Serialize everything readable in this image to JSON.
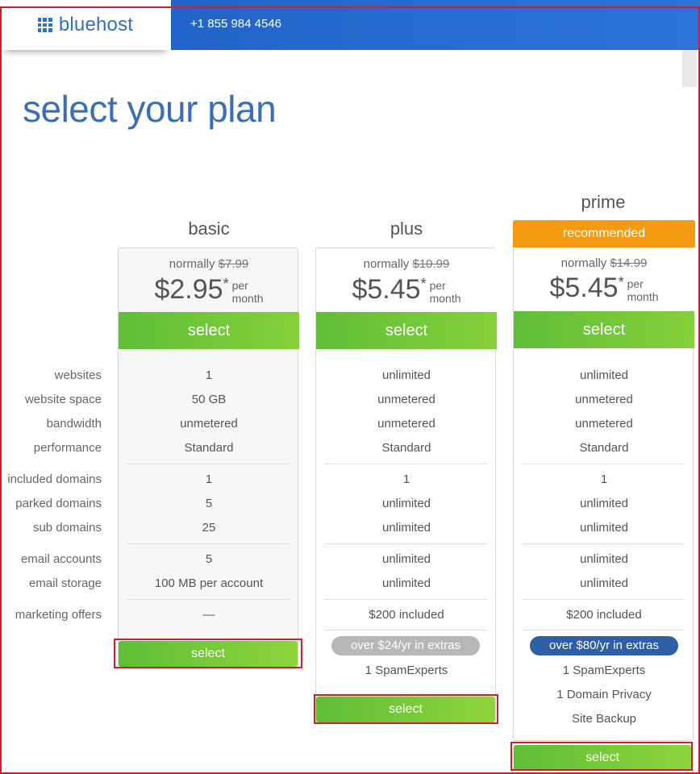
{
  "header": {
    "logo_text": "bluehost",
    "phone": "+1 855 984 4546"
  },
  "page": {
    "title": "select your plan"
  },
  "labels": [
    "websites",
    "website space",
    "bandwidth",
    "performance",
    "included domains",
    "parked domains",
    "sub domains",
    "email accounts",
    "email storage",
    "marketing offers"
  ],
  "plans": [
    {
      "name": "basic",
      "normally_text": "normally",
      "old_price": "$7.99",
      "price": "$2.95",
      "asterisk": "*",
      "per_line1": "per",
      "per_line2": "month",
      "select_label": "select",
      "values": [
        "1",
        "50 GB",
        "unmetered",
        "Standard",
        "1",
        "5",
        "25",
        "5",
        "100 MB per account",
        "—"
      ],
      "bottom_select": "select"
    },
    {
      "name": "plus",
      "normally_text": "normally",
      "old_price": "$10.99",
      "price": "$5.45",
      "asterisk": "*",
      "per_line1": "per",
      "per_line2": "month",
      "select_label": "select",
      "values": [
        "unlimited",
        "unmetered",
        "unmetered",
        "Standard",
        "1",
        "unlimited",
        "unlimited",
        "unlimited",
        "unlimited",
        "$200 included"
      ],
      "extras_badge": "over $24/yr in extras",
      "extras": [
        "1 SpamExperts"
      ],
      "bottom_select": "select"
    },
    {
      "name": "prime",
      "recommended": "recommended",
      "normally_text": "normally",
      "old_price": "$14.99",
      "price": "$5.45",
      "asterisk": "*",
      "per_line1": "per",
      "per_line2": "month",
      "select_label": "select",
      "values": [
        "unlimited",
        "unmetered",
        "unmetered",
        "Standard",
        "1",
        "unlimited",
        "unlimited",
        "unlimited",
        "unlimited",
        "$200 included"
      ],
      "extras_badge": "over $80/yr in extras",
      "extras": [
        "1 SpamExperts",
        "1 Domain Privacy",
        "Site Backup"
      ],
      "bottom_select": "select"
    }
  ],
  "colors": {
    "header_blue": "#2c74d8",
    "title_blue": "#3a6fb5",
    "green": "#6cc538",
    "orange": "#f49b12",
    "pill_blue": "#2d5ea6",
    "pill_grey": "#b7b7b7",
    "annotation_red": "#cc1f2a"
  }
}
